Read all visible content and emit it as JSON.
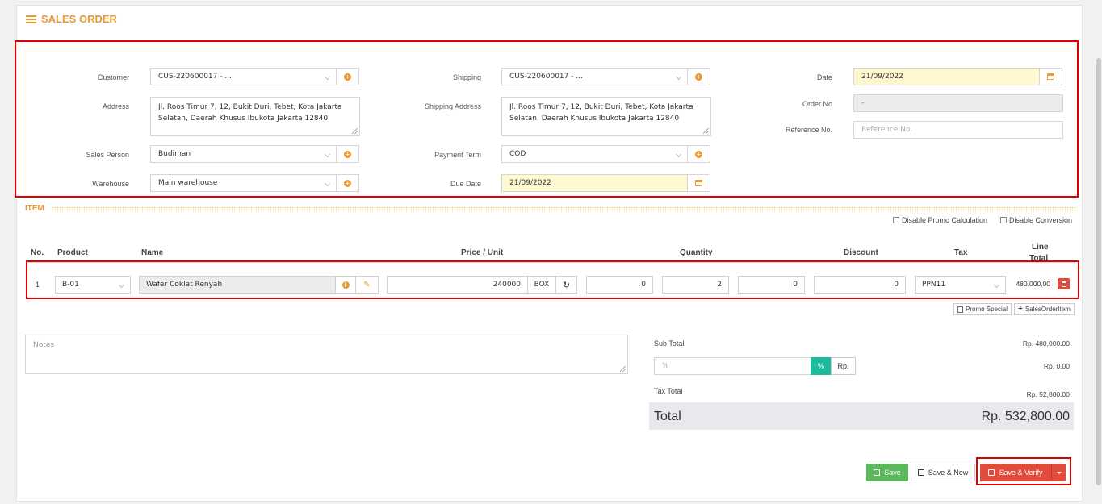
{
  "title": "SALES ORDER",
  "form": {
    "customer_label": "Customer",
    "customer_value": "CUS-220600017 - ...",
    "address_label": "Address",
    "address_value": "Jl. Roos Timur 7, 12, Bukit Duri, Tebet, Kota Jakarta Selatan, Daerah Khusus Ibukota Jakarta 12840",
    "sales_person_label": "Sales Person",
    "sales_person_value": "Budiman",
    "warehouse_label": "Warehouse",
    "warehouse_value": "Main warehouse",
    "shipping_label": "Shipping",
    "shipping_value": "CUS-220600017 - ...",
    "shipping_address_label": "Shipping Address",
    "shipping_address_value": "Jl. Roos Timur 7, 12, Bukit Duri, Tebet, Kota Jakarta Selatan, Daerah Khusus Ibukota Jakarta 12840",
    "payment_term_label": "Payment Term",
    "payment_term_value": "COD",
    "due_date_label": "Due Date",
    "due_date_value": "21/09/2022",
    "date_label": "Date",
    "date_value": "21/09/2022",
    "order_no_label": "Order No",
    "order_no_value": "-",
    "reference_label": "Reference No.",
    "reference_placeholder": "Reference No."
  },
  "item_section": {
    "title": "ITEM",
    "disable_promo": "Disable Promo Calculation",
    "disable_conversion": "Disable Conversion",
    "headers": {
      "no": "No.",
      "product": "Product",
      "name": "Name",
      "price_unit": "Price / Unit",
      "quantity": "Quantity",
      "discount": "Discount",
      "tax": "Tax",
      "line_total_1": "Line",
      "line_total_2": "Total"
    },
    "row": {
      "no": "1",
      "product": "B-01",
      "name": "Wafer Coklat Renyah",
      "price": "240000",
      "unit": "BOX",
      "qty_a": "0",
      "qty_b": "2",
      "disc_a": "0",
      "disc_b": "0",
      "tax": "PPN11",
      "line_total": "480.000,00"
    },
    "promo_special": "Promo Special",
    "sales_order_item": "SalesOrderItem"
  },
  "notes_placeholder": "Notes",
  "summary": {
    "sub_total_label": "Sub Total",
    "sub_total_value": "Rp. 480,000.00",
    "discount_placeholder": "%",
    "pct_btn": "%",
    "rp_btn": "Rp.",
    "discount_value": "Rp. 0.00",
    "tax_total_label": "Tax Total",
    "tax_total_value": "Rp. 52,800.00",
    "total_label": "Total",
    "total_value": "Rp. 532,800.00"
  },
  "actions": {
    "save": "Save",
    "save_new": "Save & New",
    "save_verify": "Save & Verify"
  },
  "colors": {
    "accent": "#e99a32",
    "save_green": "#5cb85c",
    "danger_red": "#e14b3b",
    "teal": "#1abc9c",
    "highlight_red": "#e00000"
  }
}
